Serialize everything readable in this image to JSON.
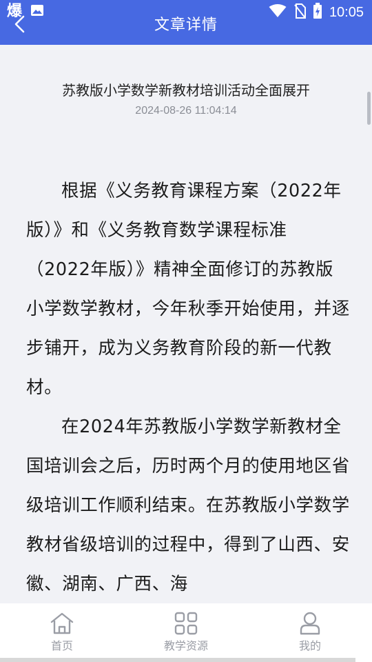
{
  "status_bar": {
    "app_glyph": "爆",
    "time": "10:05"
  },
  "header": {
    "title": "文章详情",
    "accent_color": "#4769e2"
  },
  "article": {
    "title": "苏教版小学数学新教材培训活动全面展开",
    "date": "2024-08-26 11:04:14",
    "paragraphs": [
      "根据《义务教育课程方案（2022年版）》和《义务教育数学课程标准（2022年版）》精神全面修订的苏教版小学数学教材，今年秋季开始使用，并逐步铺开，成为义务教育阶段的新一代教材。",
      "在2024年苏教版小学数学新教材全国培训会之后，历时两个月的使用地区省级培训工作顺利结束。在苏教版小学数学教材省级培训的过程中，得到了山西、安徽、湖南、广西、海"
    ]
  },
  "bottom_nav": {
    "items": [
      {
        "label": "首页",
        "icon": "home-icon"
      },
      {
        "label": "教学资源",
        "icon": "grid-icon"
      },
      {
        "label": "我的",
        "icon": "user-icon"
      }
    ]
  }
}
